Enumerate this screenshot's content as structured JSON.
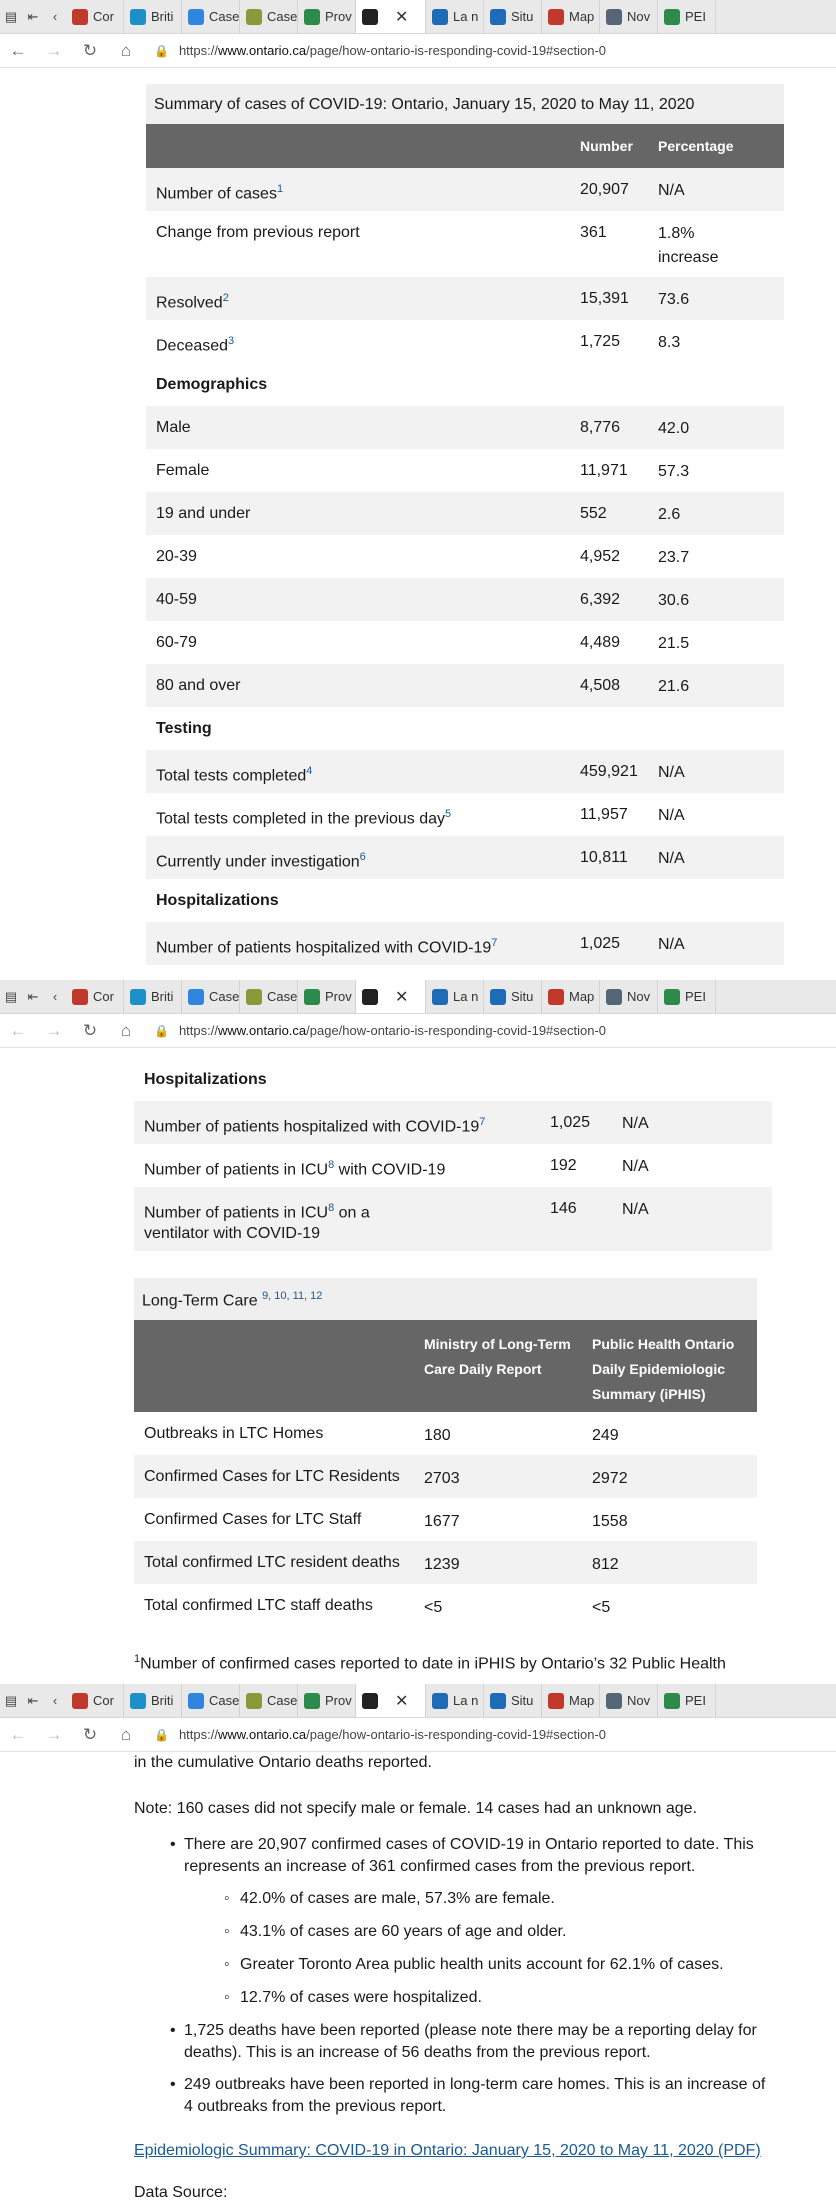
{
  "browser": {
    "tabs": [
      {
        "label": "Cor",
        "color": "#c0392b"
      },
      {
        "label": "Briti",
        "color": "#1e90c8"
      },
      {
        "label": "Case",
        "color": "#2e86de"
      },
      {
        "label": "Case",
        "color": "#8a9a3a"
      },
      {
        "label": "Prov",
        "color": "#2c8a4b"
      },
      {
        "label": "",
        "color": "#222222",
        "active": true
      },
      {
        "label": "La n",
        "color": "#1e6bb8"
      },
      {
        "label": "Situ",
        "color": "#1e6bb8"
      },
      {
        "label": "Map",
        "color": "#c0392b"
      },
      {
        "label": "Nov",
        "color": "#556677"
      },
      {
        "label": "PEI",
        "color": "#2c8a4b"
      }
    ],
    "url_prefix": "https://",
    "url_host": "www.ontario.ca",
    "url_path": "/page/how-ontario-is-responding-covid-19#section-0"
  },
  "summary": {
    "caption": "Summary of cases of COVID-19: Ontario, January 15, 2020 to May 11, 2020",
    "col_number": "Number",
    "col_pct": "Percentage",
    "rows": [
      {
        "label": "Number of cases",
        "sup": "1",
        "num": "20,907",
        "pct": "N/A"
      },
      {
        "label": "Change from previous report",
        "sup": "",
        "num": "361",
        "pct": "1.8% increase"
      },
      {
        "label": "Resolved",
        "sup": "2",
        "num": "15,391",
        "pct": "73.6"
      },
      {
        "label": "Deceased",
        "sup": "3",
        "num": "1,725",
        "pct": "8.3"
      },
      {
        "label": "Demographics",
        "section": true
      },
      {
        "label": "Male",
        "sup": "",
        "num": "8,776",
        "pct": "42.0"
      },
      {
        "label": "Female",
        "sup": "",
        "num": "11,971",
        "pct": "57.3"
      },
      {
        "label": "19 and under",
        "sup": "",
        "num": "552",
        "pct": "2.6"
      },
      {
        "label": "20-39",
        "sup": "",
        "num": "4,952",
        "pct": "23.7"
      },
      {
        "label": "40-59",
        "sup": "",
        "num": "6,392",
        "pct": "30.6"
      },
      {
        "label": "60-79",
        "sup": "",
        "num": "4,489",
        "pct": "21.5"
      },
      {
        "label": "80 and over",
        "sup": "",
        "num": "4,508",
        "pct": "21.6"
      },
      {
        "label": "Testing",
        "section": true
      },
      {
        "label": "Total tests completed",
        "sup": "4",
        "num": "459,921",
        "pct": "N/A"
      },
      {
        "label": "Total tests completed in the previous day",
        "sup": "5",
        "num": "11,957",
        "pct": "N/A"
      },
      {
        "label": "Currently under investigation",
        "sup": "6",
        "num": "10,811",
        "pct": "N/A"
      },
      {
        "label": "Hospitalizations",
        "section": true
      },
      {
        "label": "Number of patients hospitalized with COVID-19",
        "sup": "7",
        "num": "1,025",
        "pct": "N/A"
      }
    ]
  },
  "hospitalizations": {
    "heading": "Hospitalizations",
    "rows": [
      {
        "label": "Number of patients hospitalized with COVID-19",
        "sup": "7",
        "tail": "",
        "num": "1,025",
        "pct": "N/A"
      },
      {
        "label": "Number of patients in ICU",
        "sup": "8",
        "tail": " with COVID-19",
        "num": "192",
        "pct": "N/A"
      },
      {
        "label": "Number of patients in ICU",
        "sup": "8",
        "tail": " on a ventilator with COVID-19",
        "num": "146",
        "pct": "N/A"
      }
    ]
  },
  "ltc": {
    "caption": "Long-Term Care",
    "caption_sups": "9, 10, 11, 12",
    "col_a": "Ministry of Long-Term Care Daily Report",
    "col_b": "Public Health Ontario Daily Epidemiologic Summary (iPHIS)",
    "rows": [
      {
        "label": "Outbreaks in LTC Homes",
        "a": "180",
        "b": "249"
      },
      {
        "label": "Confirmed Cases for LTC Residents",
        "a": "2703",
        "b": "2972"
      },
      {
        "label": "Confirmed Cases for LTC Staff",
        "a": "1677",
        "b": "1558"
      },
      {
        "label": "Total confirmed LTC resident deaths",
        "a": "1239",
        "b": "812"
      },
      {
        "label": "Total confirmed LTC staff deaths",
        "a": "<5",
        "b": "<5"
      }
    ]
  },
  "footnote1": "Number of confirmed cases reported to date in iPHIS by Ontario’s 32 Public Health",
  "footnote1_sup": "1",
  "notes": {
    "top_line": "in the cumulative Ontario deaths reported.",
    "note": "Note: 160 cases did not specify male or female. 14 cases had an unknown age.",
    "bullet1": "There are 20,907 confirmed cases of COVID-19 in Ontario reported to date. This represents an increase of 361 confirmed cases from the previous report.",
    "sub": [
      "42.0% of cases are male, 57.3% are female.",
      "43.1% of cases are 60 years of age and older.",
      "Greater Toronto Area public health units account for 62.1% of cases.",
      "12.7% of cases were hospitalized."
    ],
    "bullet2": "1,725 deaths have been reported (please note there may be a reporting delay for deaths). This is an increase of 56 deaths from the previous report.",
    "bullet3": "249 outbreaks have been reported in long-term care homes. This is an increase of 4 outbreaks from the previous report.",
    "pdf_link": "Epidemiologic Summary: COVID-19 in Ontario: January 15, 2020 to May 11, 2020 (PDF)",
    "data_source": "Data Source:"
  }
}
